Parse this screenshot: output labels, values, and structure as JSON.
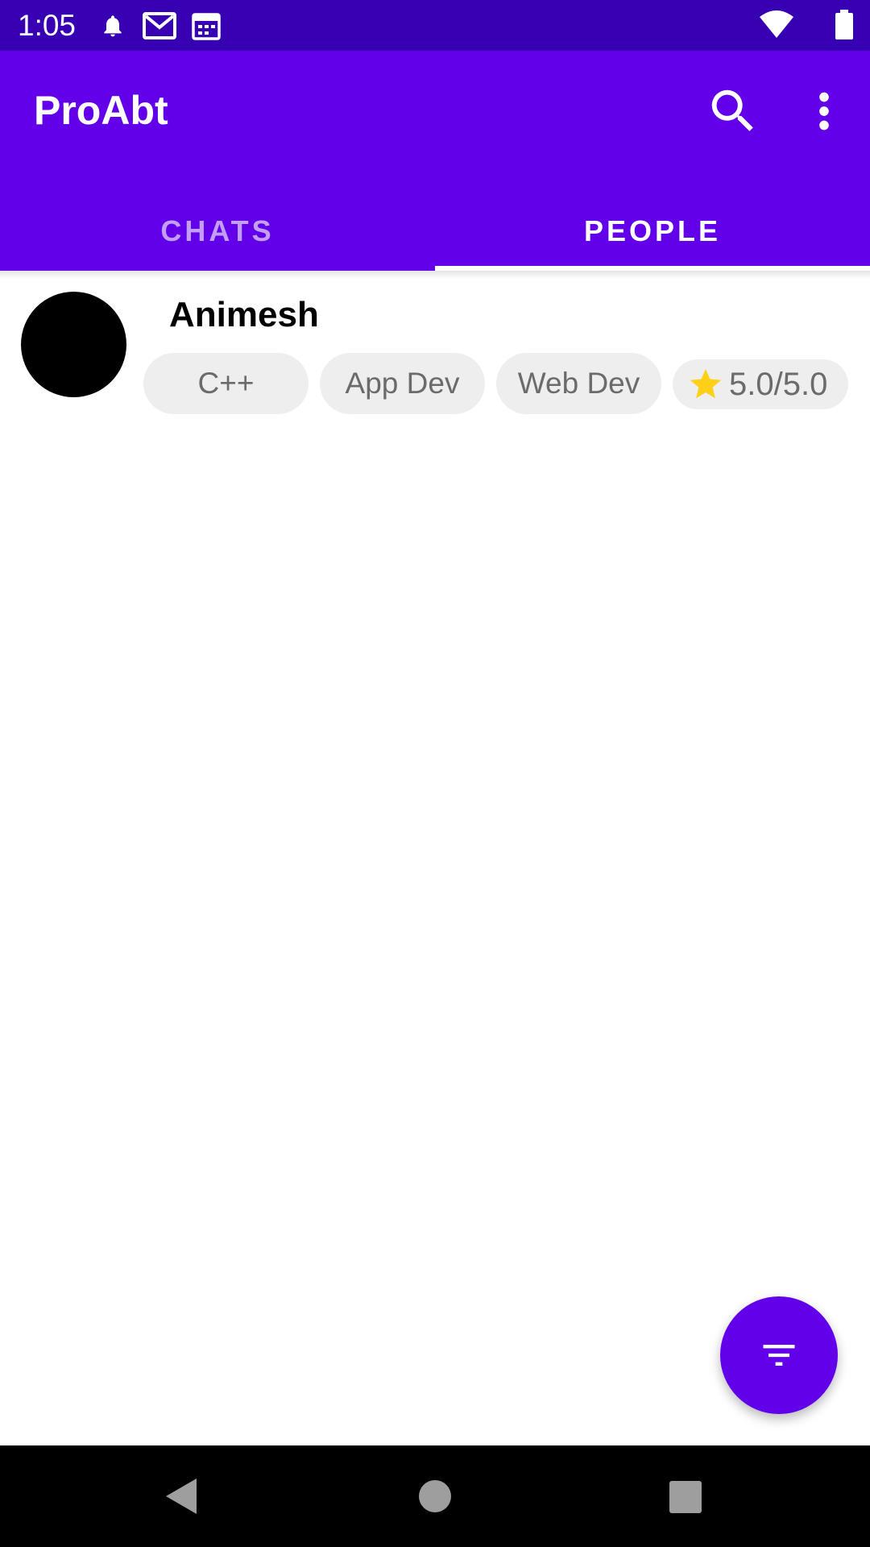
{
  "status_bar": {
    "time": "1:05",
    "left_icons": [
      "bell-icon",
      "gmail-icon",
      "calendar-icon"
    ],
    "right_icons": [
      "wifi-icon",
      "battery-icon"
    ]
  },
  "app_bar": {
    "title": "ProAbt",
    "actions": [
      "search-icon",
      "more-vert-icon"
    ]
  },
  "tabs": [
    {
      "label": "CHATS",
      "selected": false
    },
    {
      "label": "PEOPLE",
      "selected": true
    }
  ],
  "people": [
    {
      "name": "Animesh",
      "skills": [
        "C++",
        "App Dev",
        "Web Dev"
      ],
      "rating": "5.0/5.0"
    }
  ],
  "fab": {
    "icon": "filter-icon"
  },
  "colors": {
    "status_bar": "#3700b3",
    "primary": "#6200ea",
    "chip_bg": "#eeeeee",
    "star": "#fdd017"
  },
  "nav_bar": [
    "back-icon",
    "home-icon",
    "recents-icon"
  ]
}
